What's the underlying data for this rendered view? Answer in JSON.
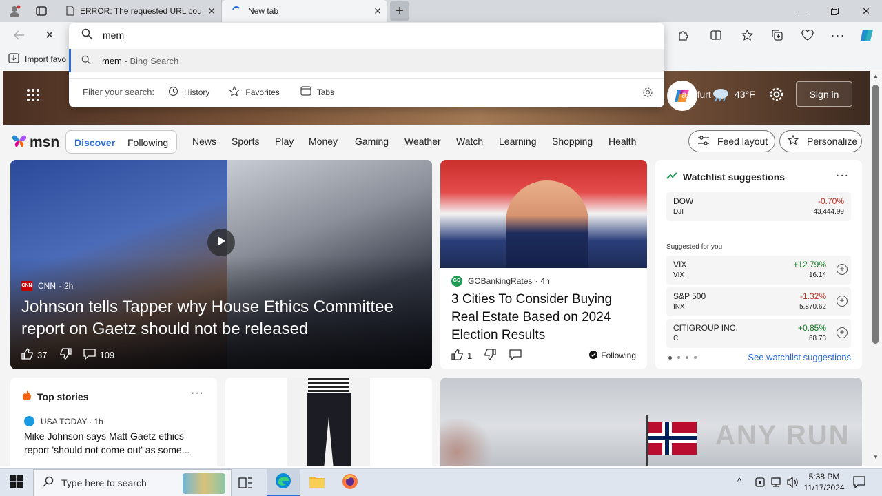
{
  "browser": {
    "tabs": [
      {
        "title": "ERROR: The requested URL could",
        "active": false
      },
      {
        "title": "New tab",
        "active": true
      }
    ],
    "address_value": "mem",
    "favorites_bar": {
      "import_label": "Import favo"
    }
  },
  "omnibox": {
    "query": "mem",
    "suggestion": {
      "term": "mem",
      "suffix": " - Bing Search"
    },
    "filter_label": "Filter your search:",
    "filters": [
      "History",
      "Favorites",
      "Tabs"
    ]
  },
  "header": {
    "location_partial": "ankfurt",
    "temperature": "43°F",
    "signin_label": "Sign in"
  },
  "msn": {
    "logo": "msn",
    "tabs": {
      "discover": "Discover",
      "following": "Following"
    },
    "nav": [
      "News",
      "Sports",
      "Play",
      "Money",
      "Gaming",
      "Weather",
      "Watch",
      "Learning",
      "Shopping",
      "Health"
    ],
    "feed_layout": "Feed layout",
    "personalize": "Personalize"
  },
  "hero_story": {
    "source": "CNN",
    "source_icon": "CNN",
    "age": "2h",
    "title": "Johnson tells Tapper why House Ethics Committee report on Gaetz should not be released",
    "likes": "37",
    "comments": "109"
  },
  "second_story": {
    "source": "GOBankingRates",
    "source_icon": "GO",
    "age": "4h",
    "title": "3 Cities To Consider Buying Real Estate Based on 2024 Election Results",
    "likes": "1",
    "following_label": "Following"
  },
  "watchlist": {
    "title": "Watchlist suggestions",
    "top": {
      "name": "DOW",
      "symbol": "DJI",
      "change": "-0.70%",
      "price": "43,444.99"
    },
    "suggested_label": "Suggested for you",
    "items": [
      {
        "name": "VIX",
        "symbol": "VIX",
        "change": "+12.79%",
        "price": "16.14"
      },
      {
        "name": "S&P 500",
        "symbol": "INX",
        "change": "-1.32%",
        "price": "5,870.62"
      },
      {
        "name": "CITIGROUP INC.",
        "symbol": "C",
        "change": "+0.85%",
        "price": "68.73"
      }
    ],
    "see_more": "See watchlist suggestions"
  },
  "top_stories": {
    "title": "Top stories",
    "source": "USA TODAY",
    "age": "1h",
    "headline": "Mike Johnson says Matt Gaetz ethics report 'should not come out' as some..."
  },
  "watermark": "ANY RUN",
  "taskbar": {
    "search_placeholder": "Type here to search",
    "time": "5:38 PM",
    "date": "11/17/2024"
  },
  "colors": {
    "accent": "#2b6cd9",
    "positive": "#0d7a20",
    "negative": "#c42b1c",
    "page_bg": "#f4f4f4"
  }
}
